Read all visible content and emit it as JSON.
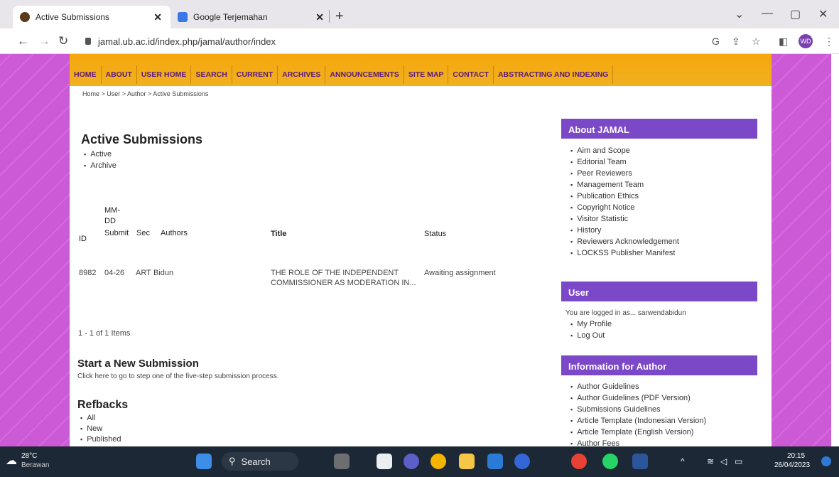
{
  "browser": {
    "tabs": [
      {
        "title": "Active Submissions"
      },
      {
        "title": "Google Terjemahan"
      }
    ],
    "url": "jamal.ub.ac.id/index.php/jamal/author/index",
    "profile": "WD"
  },
  "nav": [
    "HOME",
    "ABOUT",
    "USER HOME",
    "SEARCH",
    "CURRENT",
    "ARCHIVES",
    "ANNOUNCEMENTS",
    "SITE MAP",
    "CONTACT",
    "ABSTRACTING AND INDEXING"
  ],
  "breadcrumb": "Home > User > Author > Active Submissions",
  "main": {
    "title": "Active Submissions",
    "filters": [
      "Active",
      "Archive"
    ],
    "table": {
      "headers": {
        "id": "ID",
        "date_line1": "MM-",
        "date_line2": "DD",
        "submit": "Submit",
        "sec": "Sec",
        "authors": "Authors",
        "title": "Title",
        "status": "Status"
      },
      "rows": [
        {
          "id": "8982",
          "date": "04-26",
          "sec": "ART",
          "authors": "Bidun",
          "title": "THE ROLE OF THE INDEPENDENT COMMISSIONER AS MODERATION IN...",
          "status": "Awaiting assignment"
        }
      ],
      "summary": "1 - 1 of 1 Items"
    },
    "new_submission": {
      "heading": "Start a New Submission",
      "text": "Click here to go to step one of the five-step submission process."
    },
    "refbacks": {
      "heading": "Refbacks",
      "items": [
        "All",
        "New",
        "Published"
      ]
    }
  },
  "sidebar": {
    "about": {
      "heading": "About JAMAL",
      "items": [
        "Aim and Scope",
        "Editorial Team",
        "Peer Reviewers",
        "Management Team",
        "Publication Ethics",
        "Copyright Notice",
        "Visitor Statistic",
        "History",
        "Reviewers Acknowledgement",
        "LOCKSS Publisher Manifest"
      ]
    },
    "user": {
      "heading": "User",
      "logged_in": "You are logged in as... sarwendabidun",
      "items": [
        "My Profile",
        "Log Out"
      ]
    },
    "author": {
      "heading": "Information for Author",
      "items": [
        "Author Guidelines",
        "Author Guidelines (PDF Version)",
        "Submissions Guidelines",
        "Article Template (Indonesian Version)",
        "Article Template (English Version)",
        "Author Fees"
      ]
    }
  },
  "taskbar": {
    "temp": "28°C",
    "weather": "Berawan",
    "search": "Search",
    "time": "20:15",
    "date": "26/04/2023"
  },
  "colors": {
    "purple": "#7b48c8",
    "orange": "#f6a70c",
    "bg_pink": "#cc5ad6"
  }
}
